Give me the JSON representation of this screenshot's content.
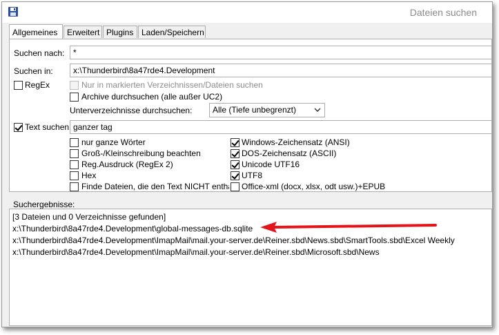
{
  "window": {
    "title": "Dateien suchen",
    "icon": "floppy-disk-icon"
  },
  "tabs": [
    {
      "label": "Allgemeines",
      "active": true
    },
    {
      "label": "Erweitert",
      "active": false
    },
    {
      "label": "Plugins",
      "active": false
    },
    {
      "label": "Laden/Speichern",
      "active": false
    }
  ],
  "form": {
    "search_for_label": "Suchen nach:",
    "search_for_value": "*",
    "search_in_label": "Suchen in:",
    "search_in_value": "x:\\Thunderbird\\8a47rde4.Development",
    "regex_label": "RegEx",
    "regex_checked": false,
    "only_marked_label": "Nur in markierten Verzeichnissen/Dateien suchen",
    "only_marked_checked": false,
    "archives_label": "Archive durchsuchen (alle außer UC2)",
    "archives_checked": false,
    "subdirs_label": "Unterverzeichnisse durchsuchen:",
    "subdirs_value": "Alle (Tiefe unbegrenzt)",
    "text_search_label": "Text suchen",
    "text_search_checked": true,
    "text_search_value": "ganzer tag"
  },
  "text_options_left": [
    {
      "label": "nur ganze Wörter",
      "checked": false
    },
    {
      "label": "Groß-/Kleinschreibung beachten",
      "checked": false
    },
    {
      "label": "Reg.Ausdruck (RegEx 2)",
      "checked": false
    },
    {
      "label": "Hex",
      "checked": false
    },
    {
      "label": "Finde Dateien, die den Text NICHT enthal",
      "checked": false
    }
  ],
  "text_options_right": [
    {
      "label": "Windows-Zeichensatz (ANSI)",
      "checked": true
    },
    {
      "label": "DOS-Zeichensatz (ASCII)",
      "checked": true
    },
    {
      "label": "Unicode UTF16",
      "checked": true
    },
    {
      "label": "UTF8",
      "checked": true
    },
    {
      "label": "Office-xml (docx, xlsx, odt usw.)+EPUB",
      "checked": false
    }
  ],
  "results": {
    "label": "Suchergebnisse:",
    "lines": [
      " [3 Dateien und 0 Verzeichnisse gefunden]",
      "x:\\Thunderbird\\8a47rde4.Development\\global-messages-db.sqlite",
      "x:\\Thunderbird\\8a47rde4.Development\\ImapMail\\mail.your-server.de\\Reiner.sbd\\News.sbd\\SmartTools.sbd\\Excel Weekly",
      "x:\\Thunderbird\\8a47rde4.Development\\ImapMail\\mail.your-server.de\\Reiner.sbd\\Microsoft.sbd\\News"
    ]
  },
  "annotation": {
    "arrow_color": "#e3151b"
  }
}
